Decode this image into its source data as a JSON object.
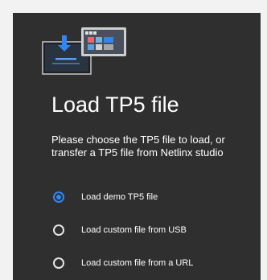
{
  "dialog": {
    "title": "Load TP5 file",
    "description": "Please choose the TP5 file to load, or transfer a TP5 file from Netlinx studio",
    "illustration_icon": "file-transfer-illustration-icon",
    "accent_color": "#2f86f6",
    "background_color": "#2f2f2f",
    "options": [
      {
        "label": "Load demo TP5 file",
        "selected": true
      },
      {
        "label": "Load custom file from USB",
        "selected": false
      },
      {
        "label": "Load custom file from a URL",
        "selected": false
      }
    ]
  }
}
